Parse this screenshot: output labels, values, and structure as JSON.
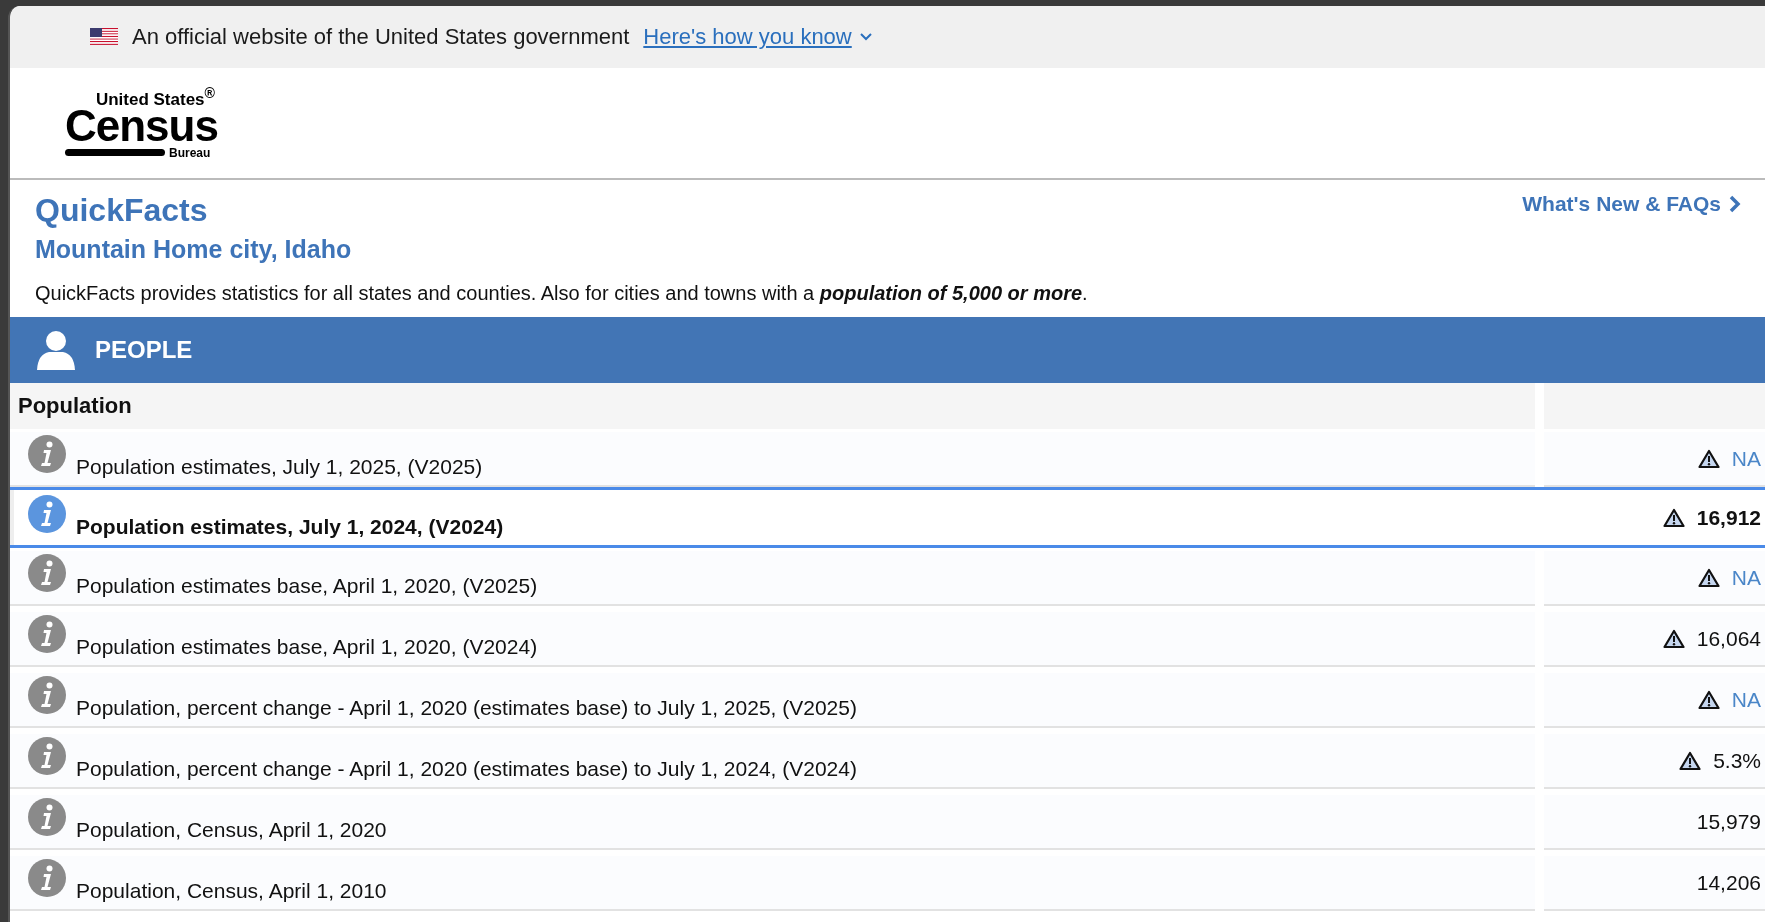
{
  "banner": {
    "text": "An official website of the United States government",
    "link": "Here's how you know"
  },
  "logo": {
    "top": "United States$^{®}$",
    "main": "Census",
    "bottom": "Bureau"
  },
  "header": {
    "title": "QuickFacts",
    "subtitle": "Mountain Home city, Idaho",
    "nav_link": "What's New & FAQs",
    "description": "QuickFacts provides statistics for all states and counties. Also for cities and towns with a **population of 5,000 or more**."
  },
  "section": {
    "title": "PEOPLE"
  },
  "table": {
    "group": "Population",
    "rows": [
      {
        "label": "Population estimates, July 1, 2025, (V2025)",
        "value": "NA",
        "kind": "link",
        "flagged": true,
        "selected": false
      },
      {
        "label": "Population estimates, July 1, 2024, (V2024)",
        "value": "16,912",
        "kind": "number",
        "flagged": true,
        "selected": true
      },
      {
        "label": "Population estimates base, April 1, 2020, (V2025)",
        "value": "NA",
        "kind": "link",
        "flagged": true,
        "selected": false
      },
      {
        "label": "Population estimates base, April 1, 2020, (V2024)",
        "value": "16,064",
        "kind": "number",
        "flagged": true,
        "selected": false
      },
      {
        "label": "Population, percent change - April 1, 2020 (estimates base) to July 1, 2025, (V2025)",
        "value": "NA",
        "kind": "link",
        "flagged": true,
        "selected": false
      },
      {
        "label": "Population, percent change - April 1, 2020 (estimates base) to July 1, 2024, (V2024)",
        "value": "5.3%",
        "kind": "number",
        "flagged": true,
        "selected": false
      },
      {
        "label": "Population, Census, April 1, 2020",
        "value": "15,979",
        "kind": "number",
        "flagged": false,
        "selected": false
      },
      {
        "label": "Population, Census, April 1, 2010",
        "value": "14,206",
        "kind": "number",
        "flagged": false,
        "selected": false
      }
    ]
  }
}
